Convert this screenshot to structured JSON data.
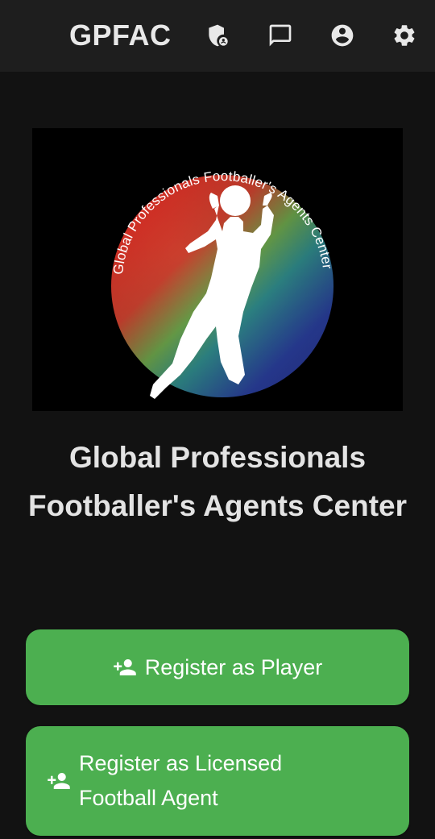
{
  "header": {
    "brand": "GPFAC",
    "icons": [
      "admin-shield-icon",
      "chat-icon",
      "account-circle-icon",
      "settings-gear-icon"
    ]
  },
  "logo": {
    "ring_text": "Global Professionals Footballer's Agents Center"
  },
  "main": {
    "title": "Global Professionals Footballer's Agents Center"
  },
  "actions": {
    "register_player": "Register as Player",
    "register_agent": "Register as Licensed Football Agent"
  },
  "colors": {
    "background": "#121212",
    "topbar": "#1e1e1e",
    "button": "#4caf50",
    "text": "#e6e6e6"
  }
}
